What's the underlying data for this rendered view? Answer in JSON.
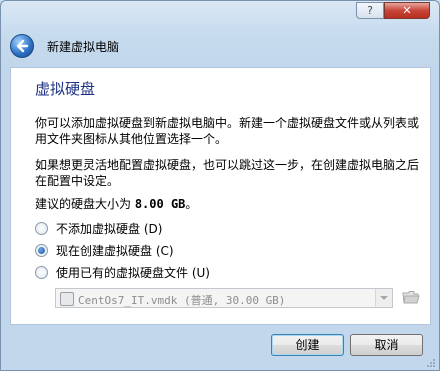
{
  "titlebar": {
    "help_glyph": "?",
    "close_glyph": "✕"
  },
  "wizard": {
    "back_icon": "back-arrow-icon",
    "title": "新建虚拟电脑"
  },
  "page": {
    "heading": "虚拟硬盘",
    "para1": "你可以添加虚拟硬盘到新虚拟电脑中。新建一个虚拟硬盘文件或从列表或用文件夹图标从其他位置选择一个。",
    "para2": "如果想更灵活地配置虚拟硬盘，也可以跳过这一步，在创建虚拟电脑之后在配置中设定。",
    "size_prefix": "建议的硬盘大小为 ",
    "size_value": "8.00 GB",
    "size_suffix": "。"
  },
  "options": [
    {
      "label": "不添加虚拟硬盘 (D)",
      "checked": false
    },
    {
      "label": "现在创建虚拟硬盘 (C)",
      "checked": true
    },
    {
      "label": "使用已有的虚拟硬盘文件 (U)",
      "checked": false
    }
  ],
  "existing_disk": {
    "selected": "CentOs7_IT.vmdk (普通, 30.00 GB)",
    "enabled": false
  },
  "buttons": {
    "create": "创建",
    "cancel": "取消"
  },
  "colors": {
    "heading": "#1e3287",
    "frame": "#c8dcef",
    "close": "#c9453a"
  }
}
